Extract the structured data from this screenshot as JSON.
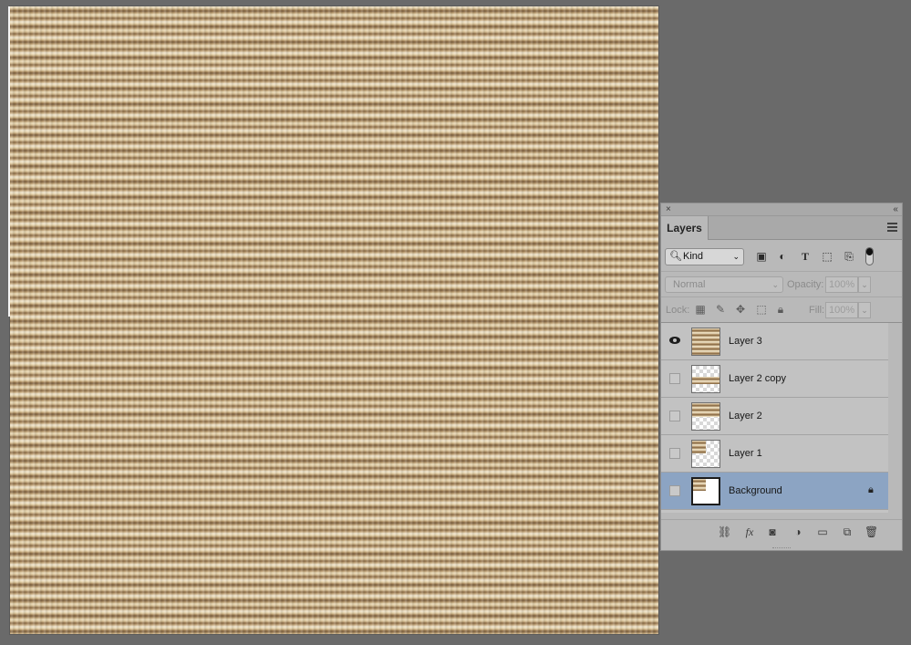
{
  "canvas": {
    "description_icon": "texture-canvas"
  },
  "panel": {
    "close_label": "×",
    "collapse_label": "‹‹",
    "tab_label": "Layers",
    "menu_icon": "hamburger-icon",
    "filter": {
      "kind_label": "Kind",
      "icons": [
        "image-filter-icon",
        "adjustment-filter-icon",
        "type-filter-icon",
        "shape-filter-icon",
        "smart-object-filter-icon"
      ]
    },
    "blend_mode": "Normal",
    "opacity_label": "Opacity:",
    "opacity_value": "100%",
    "lock_label": "Lock:",
    "fill_label": "Fill:",
    "fill_value": "100%",
    "layers": [
      {
        "name": "Layer 3",
        "visible": true,
        "selected": false
      },
      {
        "name": "Layer 2 copy",
        "visible": false,
        "selected": false
      },
      {
        "name": "Layer 2",
        "visible": false,
        "selected": false
      },
      {
        "name": "Layer 1",
        "visible": false,
        "selected": false
      },
      {
        "name": "Background",
        "visible": false,
        "selected": true,
        "locked": true
      }
    ],
    "footer_icons": [
      "link-icon",
      "fx-icon",
      "mask-icon",
      "adjustment-icon",
      "folder-icon",
      "new-layer-icon",
      "trash-icon"
    ],
    "colors": {
      "selected_row": "#8ca4c3",
      "panel_bg": "#b9b9b9",
      "workspace_bg": "#6a6a6a"
    }
  }
}
